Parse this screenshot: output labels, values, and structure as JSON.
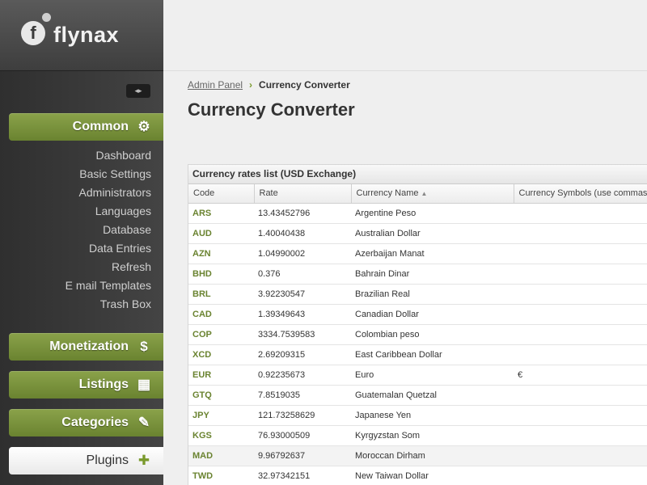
{
  "brand": {
    "name": "flynax",
    "mark": "f"
  },
  "sidebar": {
    "collapse_icon": "◂▸",
    "groups": [
      {
        "label": "Common",
        "icon": "⚙"
      },
      {
        "label": "Monetization",
        "icon": "$"
      },
      {
        "label": "Listings",
        "icon": "▦"
      },
      {
        "label": "Categories",
        "icon": "✎"
      },
      {
        "label": "Plugins",
        "icon": "✚"
      }
    ],
    "common_items": [
      "Dashboard",
      "Basic Settings",
      "Administrators",
      "Languages",
      "Database",
      "Data Entries",
      "Refresh",
      "E mail Templates",
      "Trash Box"
    ]
  },
  "breadcrumb": {
    "root": "Admin Panel",
    "separator": "›",
    "current": "Currency Converter"
  },
  "page_title": "Currency Converter",
  "table": {
    "title": "Currency rates list (USD Exchange)",
    "columns": [
      "Code",
      "Rate",
      "Currency Name",
      "Currency Symbols (use commas"
    ],
    "sort_indicator": "▲",
    "rows": [
      {
        "code": "ARS",
        "rate": "13.43452796",
        "name": "Argentine Peso",
        "symbol": ""
      },
      {
        "code": "AUD",
        "rate": "1.40040438",
        "name": "Australian Dollar",
        "symbol": ""
      },
      {
        "code": "AZN",
        "rate": "1.04990002",
        "name": "Azerbaijan Manat",
        "symbol": ""
      },
      {
        "code": "BHD",
        "rate": "0.376",
        "name": "Bahrain Dinar",
        "symbol": ""
      },
      {
        "code": "BRL",
        "rate": "3.92230547",
        "name": "Brazilian Real",
        "symbol": ""
      },
      {
        "code": "CAD",
        "rate": "1.39349643",
        "name": "Canadian Dollar",
        "symbol": ""
      },
      {
        "code": "COP",
        "rate": "3334.7539583",
        "name": "Colombian peso",
        "symbol": ""
      },
      {
        "code": "XCD",
        "rate": "2.69209315",
        "name": "East Caribbean Dollar",
        "symbol": ""
      },
      {
        "code": "EUR",
        "rate": "0.92235673",
        "name": "Euro",
        "symbol": "€"
      },
      {
        "code": "GTQ",
        "rate": "7.8519035",
        "name": "Guatemalan Quetzal",
        "symbol": ""
      },
      {
        "code": "JPY",
        "rate": "121.73258629",
        "name": "Japanese Yen",
        "symbol": ""
      },
      {
        "code": "KGS",
        "rate": "76.93000509",
        "name": "Kyrgyzstan Som",
        "symbol": ""
      },
      {
        "code": "MAD",
        "rate": "9.96792637",
        "name": "Moroccan Dirham",
        "symbol": ""
      },
      {
        "code": "TWD",
        "rate": "32.97342151",
        "name": "New Taiwan Dollar",
        "symbol": ""
      }
    ]
  }
}
